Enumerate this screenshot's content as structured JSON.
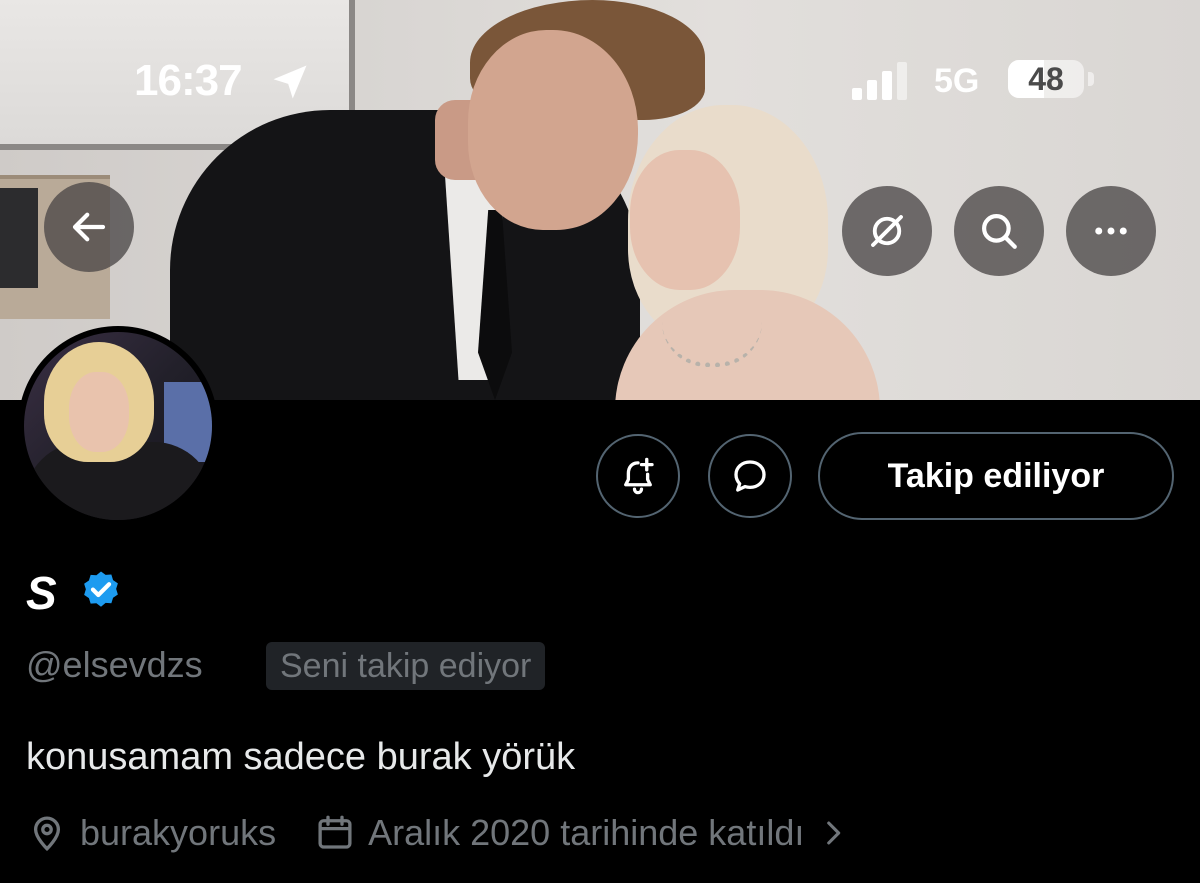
{
  "status_bar": {
    "time": "16:37",
    "network": "5G",
    "battery": "48",
    "battery_level": 0.48
  },
  "icons": {
    "back": "arrow-left-icon",
    "grok": "grok-icon",
    "search": "search-icon",
    "more": "more-dots-icon",
    "notify": "bell-plus-icon",
    "message": "chat-bubble-icon",
    "verified": "verified-badge-icon",
    "location": "location-pin-icon",
    "calendar": "calendar-icon",
    "chevron": "chevron-right-icon"
  },
  "profile": {
    "display_name": "S",
    "handle": "@elsevdzs",
    "follows_you_badge": "Seni takip ediyor",
    "bio": "konusamam sadece burak yörük",
    "location": "burakyoruks",
    "joined": "Aralık 2020 tarihinde katıldı"
  },
  "actions": {
    "follow_label": "Takip ediliyor"
  },
  "colors": {
    "background": "#000000",
    "verified_blue": "#1d9bf0",
    "secondary_text": "#71767b",
    "button_border": "#536471"
  }
}
